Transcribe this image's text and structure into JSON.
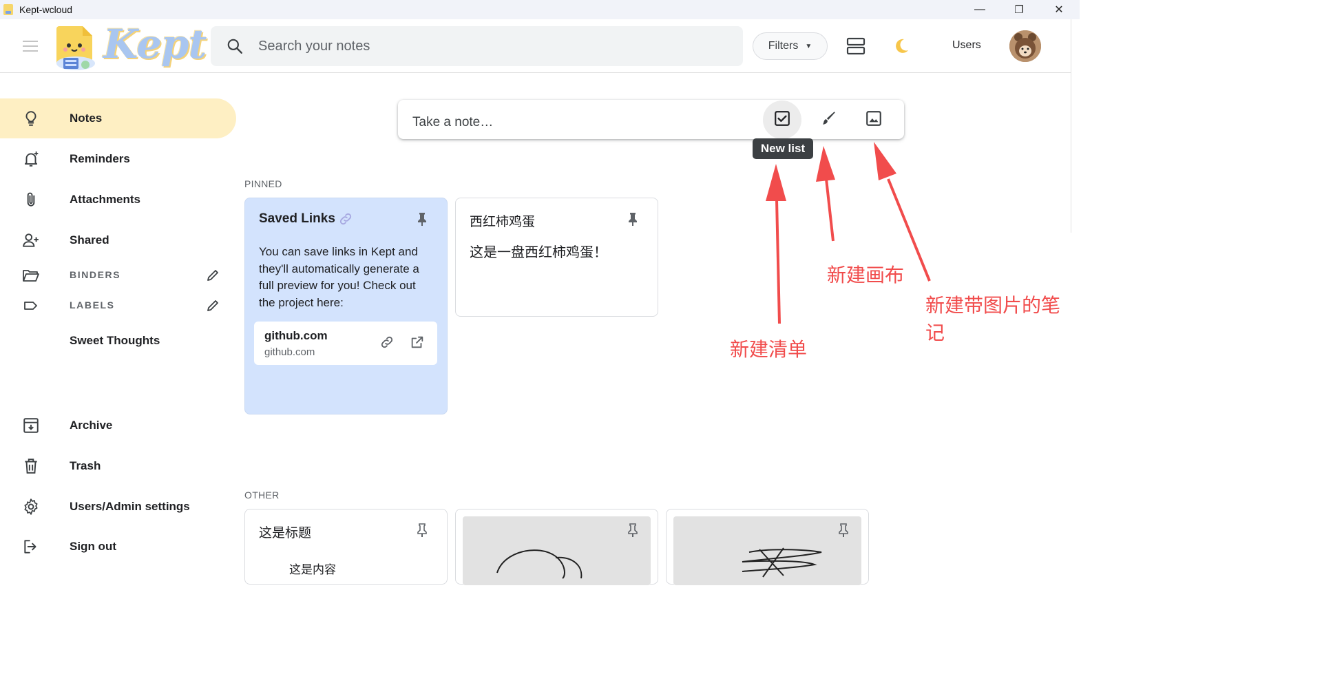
{
  "window": {
    "title": "Kept-wcloud",
    "controls": {
      "minimize": "—",
      "restore": "❐",
      "close": "✕"
    }
  },
  "header": {
    "logo_text": "Kept",
    "search_placeholder": "Search your notes",
    "filters_label": "Filters",
    "users_label": "Users"
  },
  "sidebar": {
    "items": [
      {
        "label": "Notes",
        "icon": "lightbulb-icon",
        "active": true
      },
      {
        "label": "Reminders",
        "icon": "bell-add-icon"
      },
      {
        "label": "Attachments",
        "icon": "paperclip-icon"
      },
      {
        "label": "Shared",
        "icon": "person-add-icon"
      }
    ],
    "binders_label": "BINDERS",
    "labels_label": "LABELS",
    "label_items": [
      "Sweet Thoughts"
    ],
    "bottom_items": [
      {
        "label": "Archive",
        "icon": "archive-icon"
      },
      {
        "label": "Trash",
        "icon": "trash-icon"
      },
      {
        "label": "Users/Admin settings",
        "icon": "gear-icon"
      },
      {
        "label": "Sign out",
        "icon": "sign-out-icon"
      }
    ]
  },
  "composer": {
    "placeholder": "Take a note…",
    "tooltip": "New list"
  },
  "pinned": {
    "label": "PINNED",
    "cards": [
      {
        "title": "Saved Links",
        "body_lines": [
          "You can save links in Kept and",
          "they'll automatically generate a",
          "full preview for you! Check out",
          "the project here:"
        ],
        "link": {
          "title": "github.com",
          "domain": "github.com"
        },
        "color": "#d3e3fd"
      },
      {
        "title": "西红柿鸡蛋",
        "body": "这是一盘西红柿鸡蛋！"
      }
    ]
  },
  "other": {
    "label": "OTHER",
    "cards": [
      {
        "title": "这是标题",
        "body": "这是内容"
      },
      {
        "type": "canvas"
      },
      {
        "type": "canvas"
      }
    ]
  },
  "annotations": {
    "new_list": "新建清单",
    "new_canvas": "新建画布",
    "new_image_note": [
      "新建带图片的笔",
      "记"
    ],
    "color": "#f14c4c"
  }
}
